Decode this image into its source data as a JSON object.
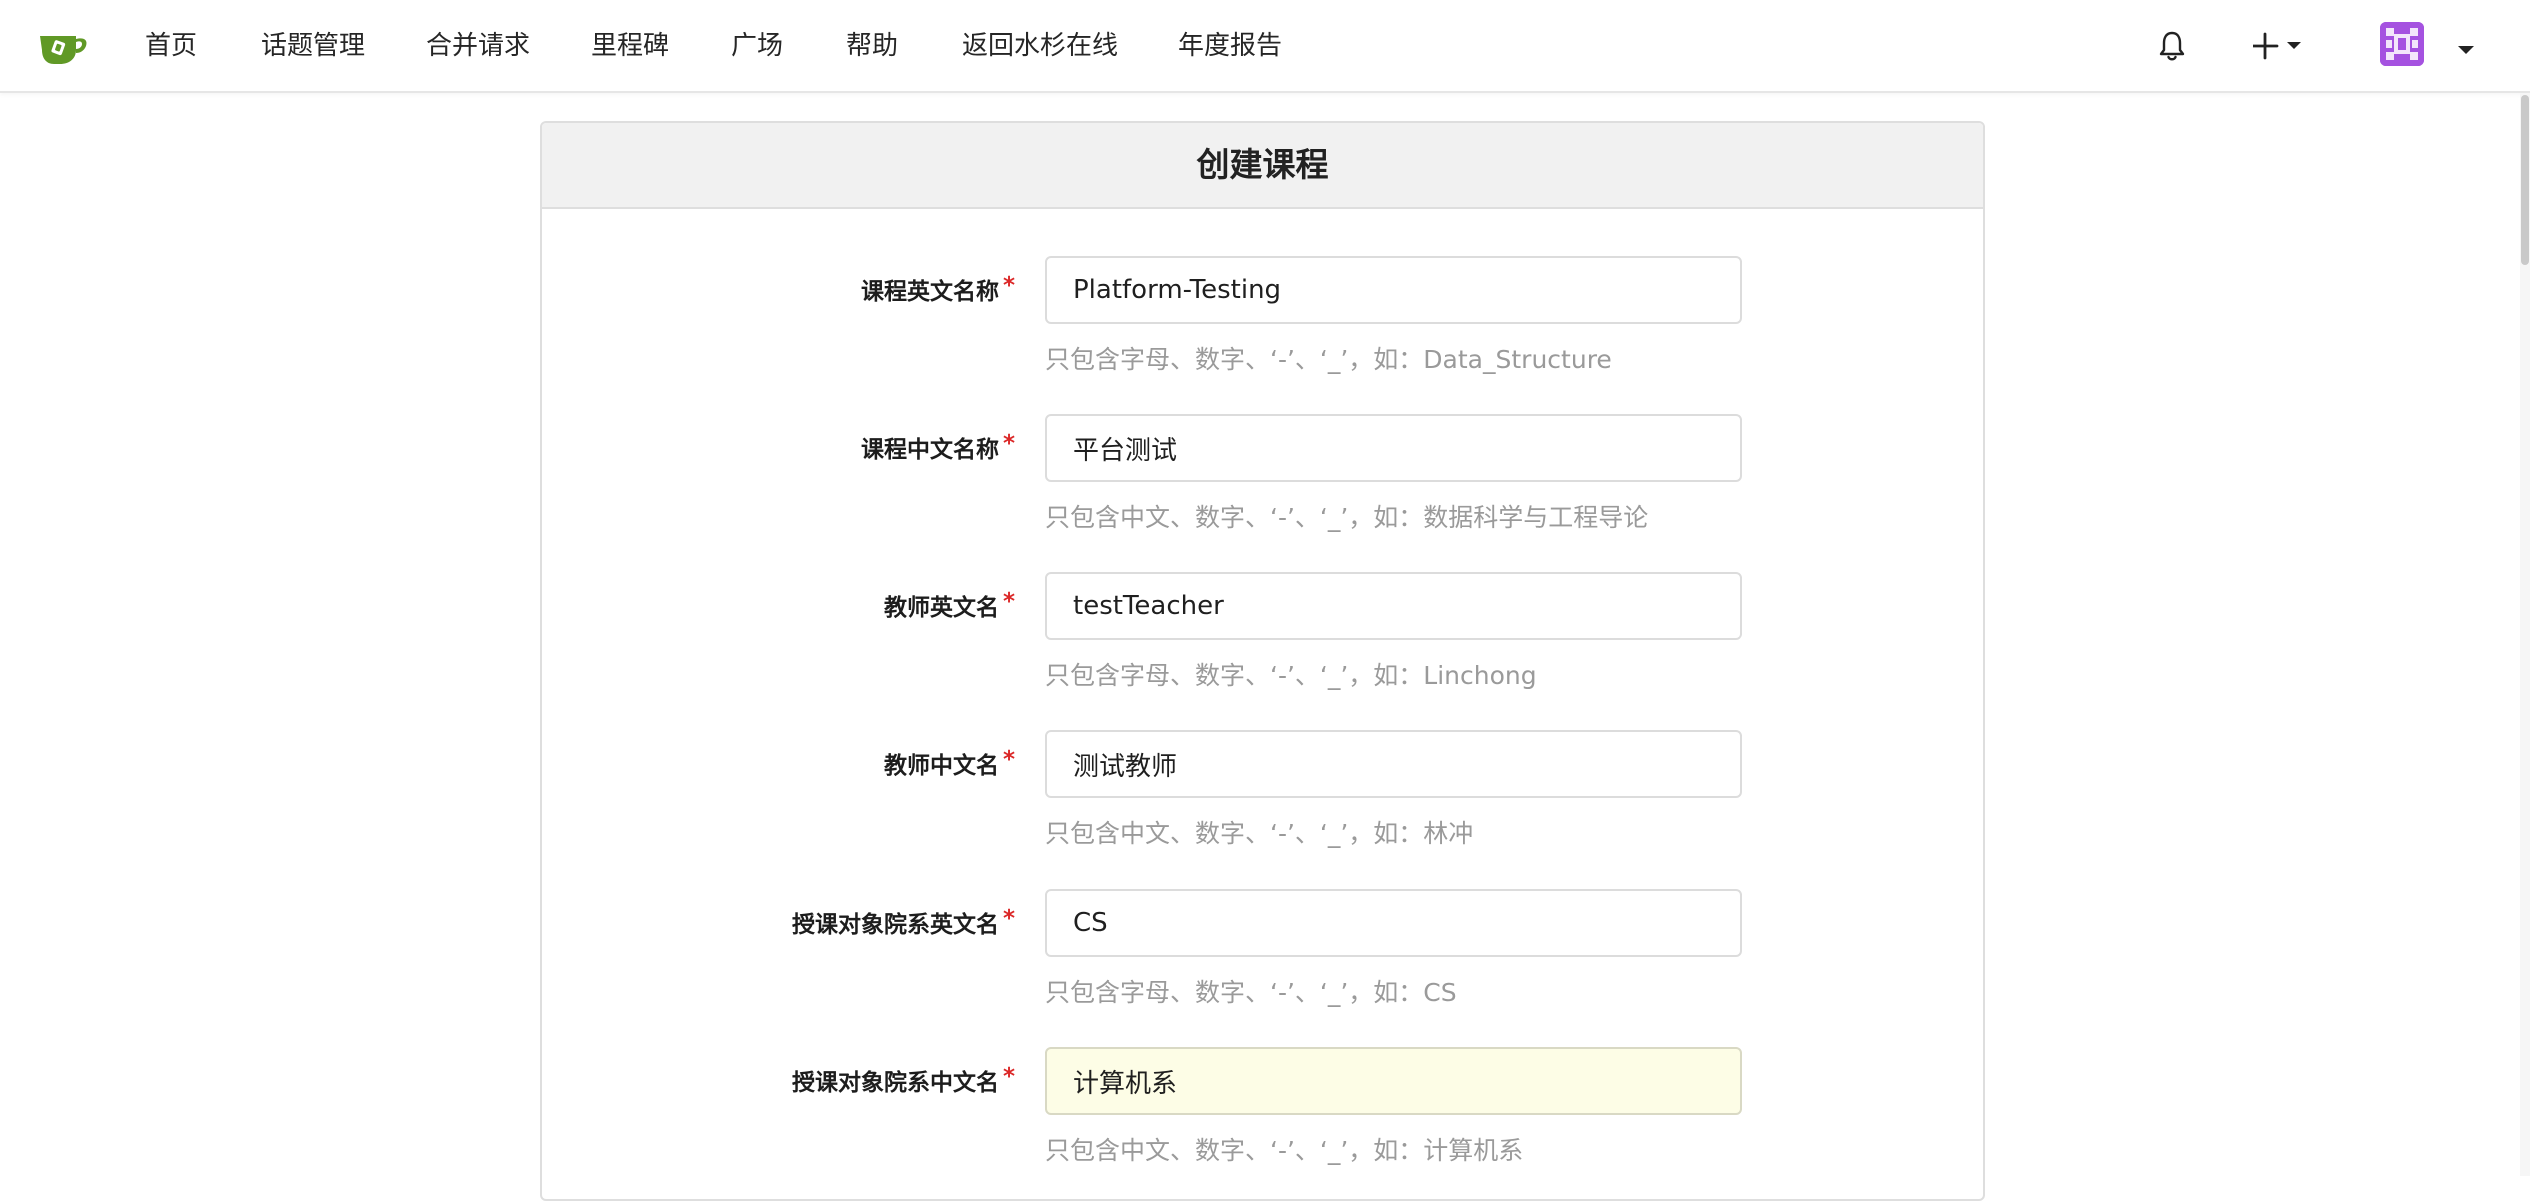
{
  "navbar": {
    "logo_icon": "gitea-teacup-logo-icon",
    "links": [
      "首页",
      "话题管理",
      "合并请求",
      "里程碑",
      "广场",
      "帮助",
      "返回水杉在线",
      "年度报告"
    ],
    "bell_icon": "bell-icon",
    "create_icon": "plus-icon",
    "create_caret": "chevron-down-icon",
    "avatar_icon": "user-avatar-icon",
    "avatar_caret": "chevron-down-icon",
    "accent_color": "#609926"
  },
  "form": {
    "title": "创建课程",
    "required_mark": "*",
    "fields": [
      {
        "label": "课程英文名称",
        "value": "Platform-Testing",
        "hint": "只包含字母、数字、‘-’、‘_’，如：Data_Structure"
      },
      {
        "label": "课程中文名称",
        "value": "平台测试",
        "hint": "只包含中文、数字、‘-’、‘_’，如：数据科学与工程导论"
      },
      {
        "label": "教师英文名",
        "value": "testTeacher",
        "hint": "只包含字母、数字、‘-’、‘_’，如：Linchong"
      },
      {
        "label": "教师中文名",
        "value": "测试教师",
        "hint": "只包含中文、数字、‘-’、‘_’，如：林冲"
      },
      {
        "label": "授课对象院系英文名",
        "value": "CS",
        "hint": "只包含字母、数字、‘-’、‘_’，如：CS"
      },
      {
        "label": "授课对象院系中文名",
        "value": "计算机系",
        "hint": "只包含中文、数字、‘-’、‘_’，如：计算机系"
      }
    ]
  }
}
